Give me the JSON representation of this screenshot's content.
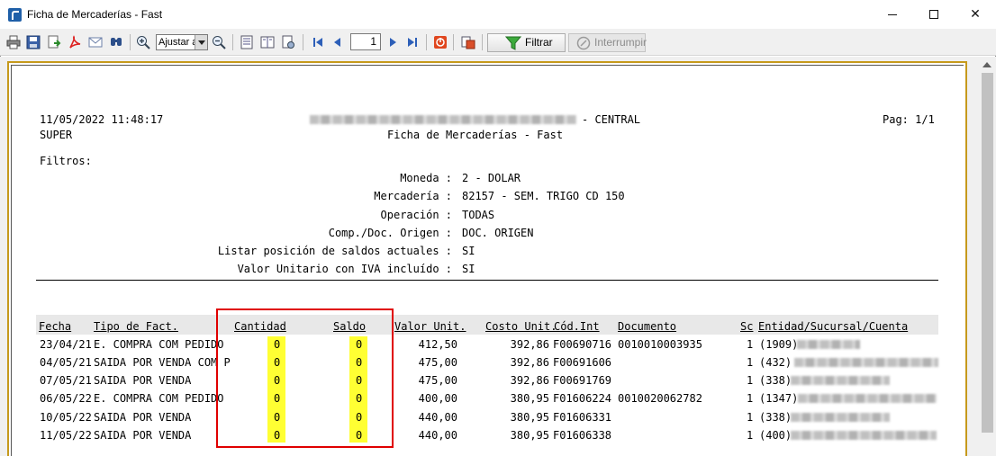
{
  "window": {
    "title": "Ficha de Mercaderías - Fast"
  },
  "toolbar": {
    "zoom_value": "Ajustar a",
    "page_number": "1",
    "filter_label": "Filtrar",
    "interrupt_label": "Interrumpir"
  },
  "report": {
    "datetime": "11/05/2022 11:48:17",
    "user": "SUPER",
    "company_suffix": "- CENTRAL",
    "title": "Ficha de Mercaderías - Fast",
    "page": "Pag: 1/1",
    "filters_label": "Filtros:",
    "filters": [
      {
        "label": "Moneda :",
        "value": "2 - DOLAR"
      },
      {
        "label": "Mercadería :",
        "value": "82157 - SEM. TRIGO CD 150"
      },
      {
        "label": "Operación :",
        "value": "TODAS"
      },
      {
        "label": "Comp./Doc. Origen :",
        "value": "DOC. ORIGEN"
      },
      {
        "label": "Listar posición de saldos actuales :",
        "value": "SI"
      },
      {
        "label": "Valor Unitario con IVA incluído :",
        "value": "SI"
      }
    ],
    "columns": {
      "fecha": "Fecha",
      "tipo": "Tipo de Fact.",
      "cantidad": "Cantidad",
      "saldo": "Saldo",
      "valor_unit": "Valor Unit.",
      "costo_unit": "Costo Unit.",
      "cod_int": "Cód.Int",
      "documento": "Documento",
      "sc": "Sc",
      "entidad": "Entidad/Sucursal/Cuenta"
    },
    "rows": [
      {
        "fecha": "23/04/21",
        "tipo": "E. COMPRA COM PEDIDO",
        "cantidad": "0",
        "saldo": "0",
        "valor_unit": "412,50",
        "costo_unit": "392,86",
        "cod_int": "F00690716",
        "documento": "0010010003935",
        "sc": "1",
        "entidad": "(1909)"
      },
      {
        "fecha": "04/05/21",
        "tipo": "SAIDA POR VENDA COM P",
        "cantidad": "0",
        "saldo": "0",
        "valor_unit": "475,00",
        "costo_unit": "392,86",
        "cod_int": "F00691606",
        "documento": "",
        "sc": "1",
        "entidad": "(432)"
      },
      {
        "fecha": "07/05/21",
        "tipo": "SAIDA POR VENDA",
        "cantidad": "0",
        "saldo": "0",
        "valor_unit": "475,00",
        "costo_unit": "392,86",
        "cod_int": "F00691769",
        "documento": "",
        "sc": "1",
        "entidad": "(338)"
      },
      {
        "fecha": "06/05/22",
        "tipo": "E. COMPRA COM PEDIDO",
        "cantidad": "0",
        "saldo": "0",
        "valor_unit": "400,00",
        "costo_unit": "380,95",
        "cod_int": "F01606224",
        "documento": "0010020062782",
        "sc": "1",
        "entidad": "(1347)"
      },
      {
        "fecha": "10/05/22",
        "tipo": "SAIDA POR VENDA",
        "cantidad": "0",
        "saldo": "0",
        "valor_unit": "440,00",
        "costo_unit": "380,95",
        "cod_int": "F01606331",
        "documento": "",
        "sc": "1",
        "entidad": "(338)"
      },
      {
        "fecha": "11/05/22",
        "tipo": "SAIDA POR VENDA",
        "cantidad": "0",
        "saldo": "0",
        "valor_unit": "440,00",
        "costo_unit": "380,95",
        "cod_int": "F01606338",
        "documento": "",
        "sc": "1",
        "entidad": "(400)"
      }
    ]
  },
  "colors": {
    "highlight": "#ffff33",
    "annotation_box": "#e00000",
    "frame": "#c69a1c"
  }
}
